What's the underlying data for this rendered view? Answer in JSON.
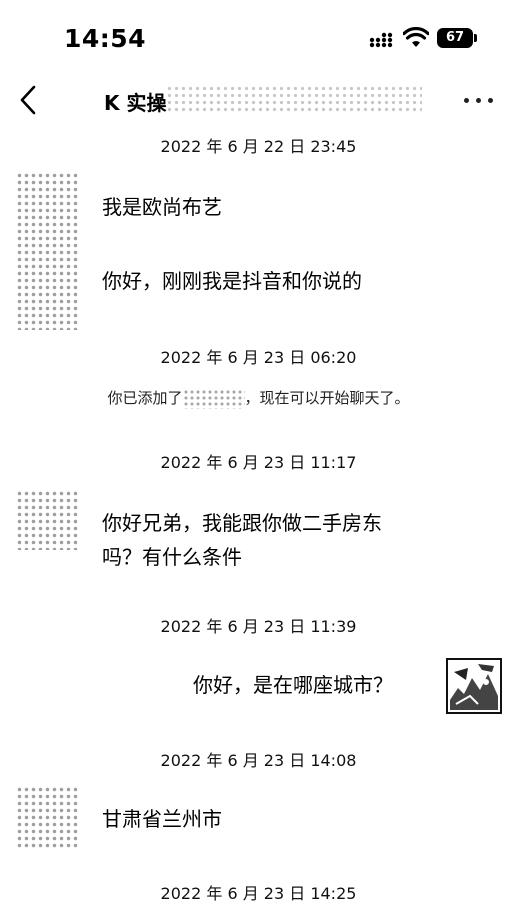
{
  "status": {
    "time": "14:54",
    "battery": "67"
  },
  "nav": {
    "title": "K 实操"
  },
  "timestamps": [
    "2022 年 6 月 22 日 23:45",
    "2022 年 6 月 23 日 06:20",
    "2022 年 6 月 23 日 11:17",
    "2022 年 6 月 23 日 11:39",
    "2022 年 6 月 23 日 14:08",
    "2022 年 6 月 23 日 14:25"
  ],
  "system": {
    "prefix": "你已添加了",
    "suffix": "，现在可以开始聊天了。"
  },
  "messages": [
    {
      "side": "left",
      "text": "我是欧尚布艺"
    },
    {
      "side": "left",
      "text": "你好，刚刚我是抖音和你说的"
    },
    {
      "side": "left",
      "line1": "你好兄弟，我能跟你做二手房东",
      "line2": "吗？有什么条件"
    },
    {
      "side": "right",
      "text": "你好，是在哪座城市？"
    },
    {
      "side": "left",
      "text": "甘肃省兰州市"
    }
  ]
}
